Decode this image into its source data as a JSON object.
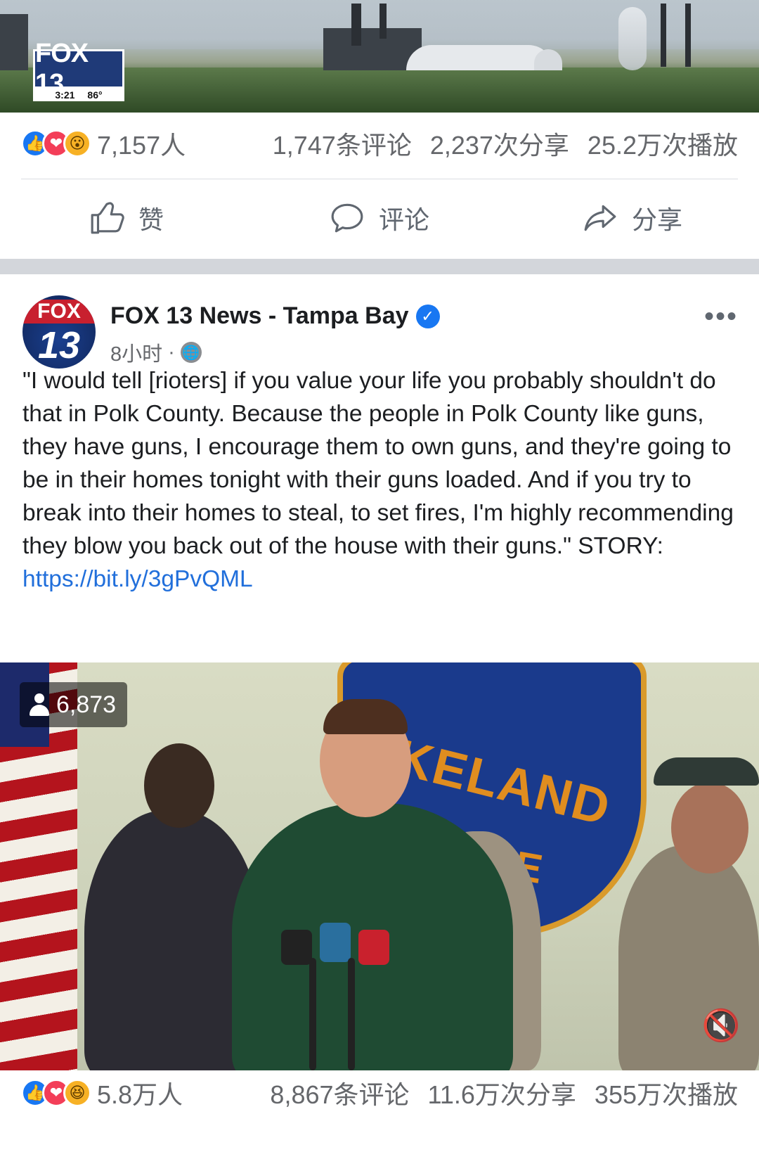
{
  "top_post": {
    "channel_bug": {
      "logo": "FOX 13",
      "time": "3:21",
      "temp": "86°"
    },
    "reaction_count": "7,157人",
    "comments": "1,747条评论",
    "shares": "2,237次分享",
    "views": "25.2万次播放",
    "actions": {
      "like": "赞",
      "comment": "评论",
      "share": "分享"
    }
  },
  "post": {
    "page_name": "FOX 13 News - Tampa Bay",
    "time_ago": "8小时",
    "dot": "·",
    "avatar_text": {
      "top": "FOX",
      "num": "13"
    },
    "text": "\"I would tell [rioters] if you value your life you probably shouldn't do that in Polk County. Because the people in Polk County like guns, they have guns, I encourage them to own guns, and they're going to be in their homes tonight with their guns loaded. And if you try to break into their homes to steal, to set fires, I'm highly recommending they blow you back out of the house with their guns.\" STORY: ",
    "link": "https://bit.ly/3gPvQML",
    "video": {
      "viewers": "6,873",
      "badge_line1": "KELAND",
      "badge_line2": "LICE"
    },
    "reaction_count": "5.8万人",
    "comments": "8,867条评论",
    "shares": "11.6万次分享",
    "views": "355万次播放"
  },
  "colors": {
    "accent": "#1877f2",
    "love": "#f33e58",
    "wow": "#f7b125",
    "link": "#216fdb"
  }
}
